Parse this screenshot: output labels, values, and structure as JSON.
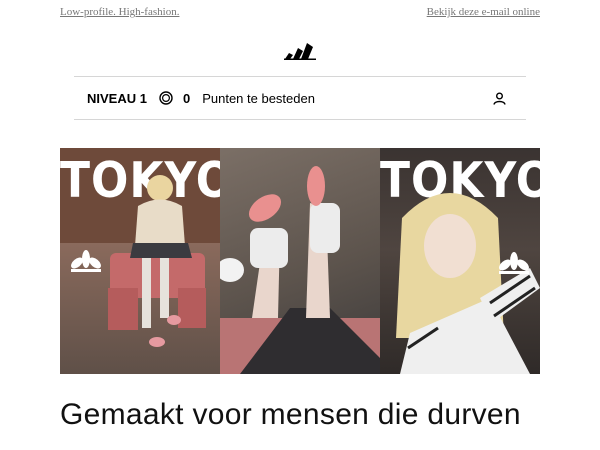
{
  "topbar": {
    "left_link": "Low-profile. High-fashion.",
    "right_link": "Bekijk deze e-mail online"
  },
  "brand": {
    "logo": "adidas-logo",
    "color": "#000000"
  },
  "loyalty": {
    "level_label": "NIVEAU 1",
    "coin_icon": "coin-icon",
    "points_value": "0",
    "points_label": "Punten te besteden",
    "user_icon": "user-icon"
  },
  "banner": {
    "panel_left_title": "TOKYO",
    "panel_right_title": "TOKYO",
    "trefoil_icon": "adidas-trefoil-icon"
  },
  "headline": "Gemaakt voor mensen die durven"
}
